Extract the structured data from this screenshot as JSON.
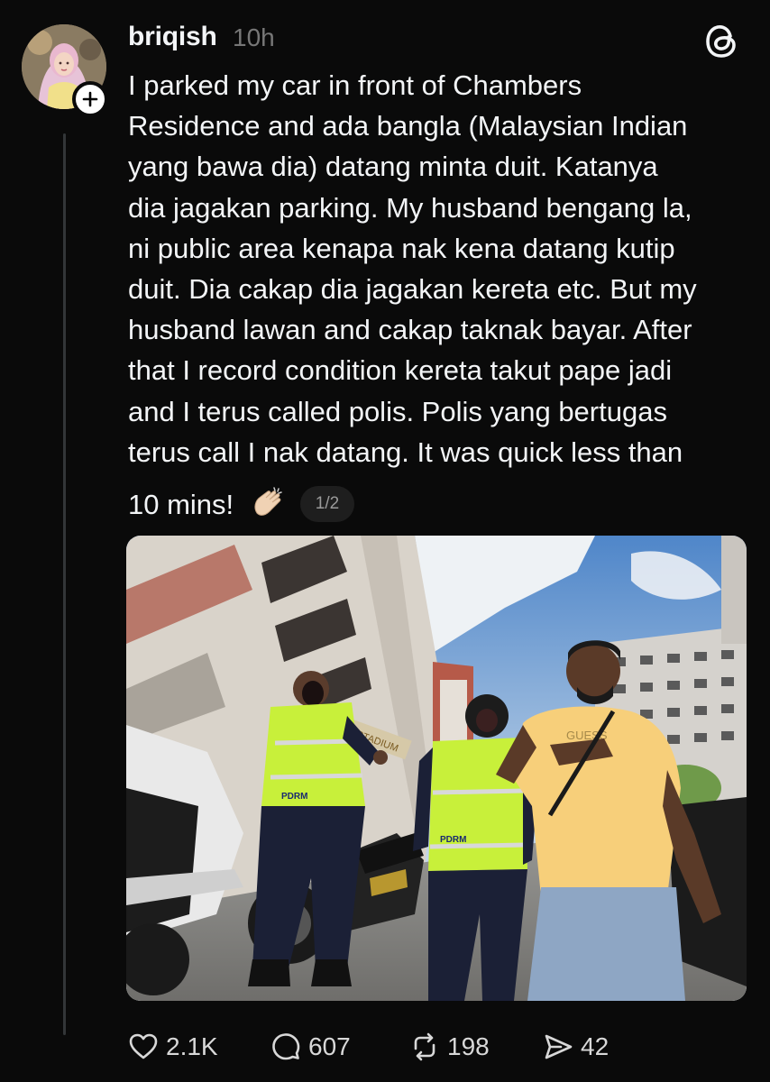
{
  "post": {
    "username": "briqish",
    "timestamp": "10h",
    "text": "I parked my car in front of Chambers\nResidence and ada bangla (Malaysian Indian\nyang bawa dia) datang minta duit. Katanya\ndia jagakan parking. My husband bengang la,\nni public area kenapa nak kena datang kutip\nduit. Dia cakap dia jagakan kereta etc. But my\nhusband lawan and cakap taknak bayar. After\nthat I record condition kereta takut pape jadi\nand I terus called polis. Polis yang bertugas\nterus call I nak datang. It was quick less than",
    "text_last_line": "10 mins!",
    "emoji": "clapping-hands-emoji",
    "page_indicator": "1/2",
    "photo": {
      "vest_text_1": "PDRM",
      "vest_text_2": "PDRM",
      "shop_sign": "STADIUM",
      "shirt_text": "GUESS"
    }
  },
  "actions": {
    "likes": "2.1K",
    "replies": "607",
    "reposts": "198",
    "shares": "42"
  },
  "icons": {
    "threads": "threads-logo-icon",
    "follow": "plus-icon",
    "like": "heart-icon",
    "reply": "comment-bubble-icon",
    "repost": "repost-icon",
    "share": "send-icon"
  },
  "colors": {
    "background": "#0a0a0a",
    "text": "#f3f5f7",
    "muted": "#777777"
  }
}
